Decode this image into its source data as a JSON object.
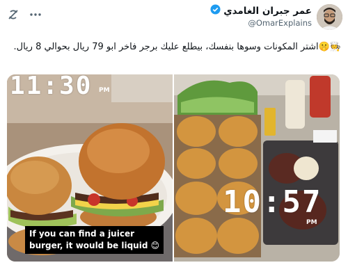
{
  "header": {
    "author_name": "عمر جبران الغامدي",
    "handle": "@OmarExplains",
    "verified_icon": "verified-badge-icon",
    "left_icons": [
      "grok-icon",
      "more-options-icon"
    ]
  },
  "tweet": {
    "text": "🧑‍🍳🤫اشتر المكونات وسوها بنفسك، بيطلع عليك برجر فاخر ابو 79 ريال بحوالي 8 ريال."
  },
  "media": {
    "left": {
      "clock": "11:30",
      "ampm": "PM",
      "caption_line1": "If you can find a juicer",
      "caption_line2": "burger, it would be liquid 😊"
    },
    "right": {
      "clock": "10:57",
      "ampm": "PM"
    }
  },
  "colors": {
    "verified": "#1d9bf0",
    "text": "#0f1419",
    "muted": "#536471"
  }
}
